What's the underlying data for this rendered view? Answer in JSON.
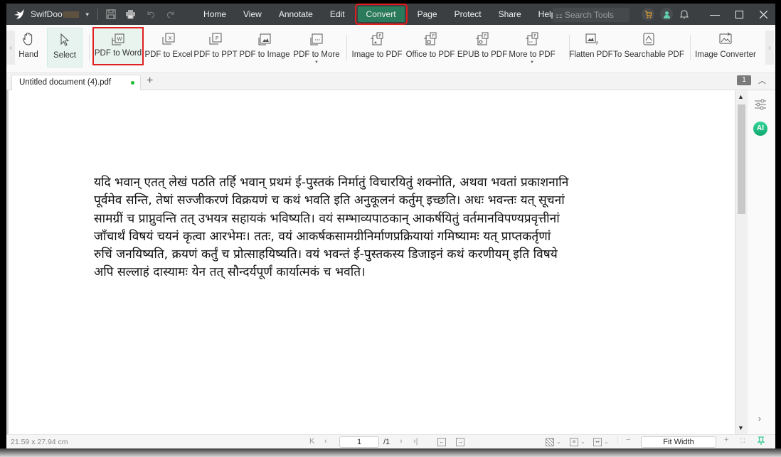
{
  "app": {
    "name": "SwifDoo",
    "quick_access": [
      "save-icon",
      "print-icon",
      "undo-icon",
      "redo-icon"
    ]
  },
  "menu": {
    "items": [
      {
        "label": "Home"
      },
      {
        "label": "View"
      },
      {
        "label": "Annotate"
      },
      {
        "label": "Edit"
      },
      {
        "label": "Convert",
        "active": true
      },
      {
        "label": "Page"
      },
      {
        "label": "Protect"
      },
      {
        "label": "Share"
      },
      {
        "label": "Help"
      }
    ],
    "search_placeholder": "Search Tools"
  },
  "ribbon": {
    "tools": [
      {
        "label": "Hand",
        "icon": "hand-icon"
      },
      {
        "label": "Select",
        "icon": "cursor-icon",
        "selected": true
      },
      {
        "label": "PDF to Word",
        "icon": "pdf-to-word-icon",
        "highlighted": true
      },
      {
        "label": "PDF to Excel",
        "icon": "pdf-to-excel-icon"
      },
      {
        "label": "PDF to PPT",
        "icon": "pdf-to-ppt-icon"
      },
      {
        "label": "PDF to Image",
        "icon": "pdf-to-image-icon"
      },
      {
        "label": "PDF to More",
        "icon": "pdf-to-more-icon",
        "dropdown": true
      },
      {
        "label": "Image to PDF",
        "icon": "image-to-pdf-icon"
      },
      {
        "label": "Office to PDF",
        "icon": "office-to-pdf-icon"
      },
      {
        "label": "EPUB to PDF",
        "icon": "epub-to-pdf-icon"
      },
      {
        "label": "More to PDF",
        "icon": "more-to-pdf-icon",
        "dropdown": true
      },
      {
        "label": "Flatten PDF",
        "icon": "flatten-pdf-icon"
      },
      {
        "label": "To Searchable PDF",
        "icon": "searchable-pdf-icon"
      },
      {
        "label": "Image Converter",
        "icon": "image-converter-icon"
      }
    ]
  },
  "tabs": {
    "document_tab": "Untitled document (4).pdf",
    "page_badge": "1"
  },
  "document": {
    "lines": [
      "यदि भवान् एतत् लेखं पठति तर्हि भवान् प्रथमं ई-पुस्तकं निर्मातुं विचारयितुं शक्नोति, अथवा भवतां प्रकाशनानि",
      "पूर्वमेव सन्ति, तेषां सज्जीकरणं विक्रयणं च कथं भवति इति अनुकूलनं कर्तुम् इच्छति। अधः भवन्तः यत् सूचनां",
      "सामग्रीं च प्राप्नुवन्ति तत् उभयत्र सहायकं भविष्यति। वयं सम्भाव्यपाठकान् आकर्षयितुं वर्तमानविपण्यप्रवृत्तीनां",
      "जाँचार्थं विषयं चयनं कृत्वा आरभेमः। ततः, वयं आकर्षकसामग्रीनिर्माणप्रक्रियायां गमिष्यामः यत् प्राप्तकर्तृणां",
      "रुचिं जनयिष्यति, क्रयणं कर्तुं च प्रोत्साहयिष्यति। वयं भवन्तं ई-पुस्तकस्य डिजाइनं कथं करणीयम् इति विषये",
      "अपि सल्लाहं दास्यामः येन तत् सौन्दर्यपूर्णं कार्यात्मकं च भवति।"
    ]
  },
  "right_panel": {
    "ai_label": "AI"
  },
  "status": {
    "page_size": "21.59 x 27.94 cm",
    "current_page": "1",
    "total_pages": "/1",
    "zoom_mode": "Fit Width"
  }
}
